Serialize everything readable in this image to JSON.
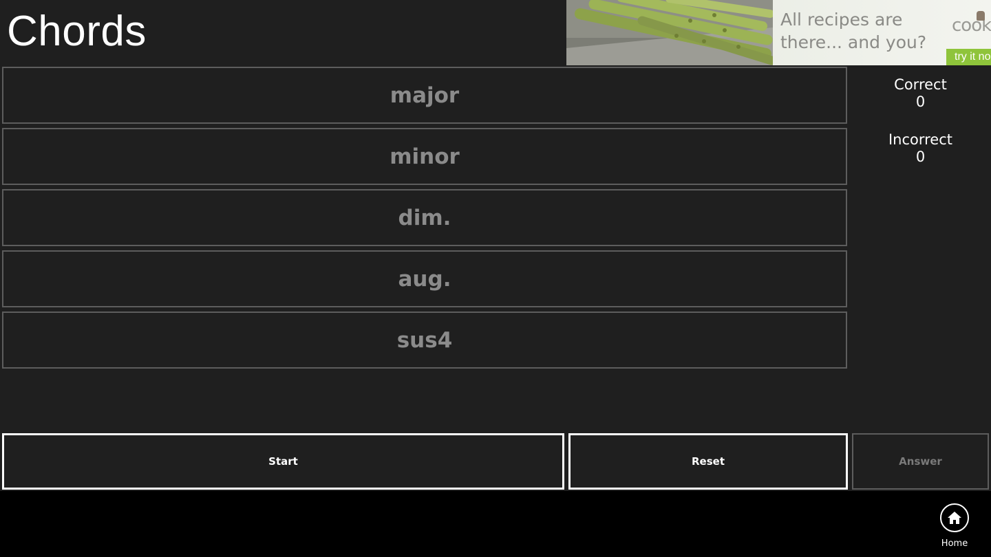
{
  "header": {
    "title": "Chords"
  },
  "ad": {
    "text": "All recipes are there... and you?",
    "brand": "cook",
    "cta": "try it no"
  },
  "options": [
    {
      "label": "major"
    },
    {
      "label": "minor"
    },
    {
      "label": "dim."
    },
    {
      "label": "aug."
    },
    {
      "label": "sus4"
    }
  ],
  "score": {
    "correct_label": "Correct",
    "correct_value": "0",
    "incorrect_label": "Incorrect",
    "incorrect_value": "0"
  },
  "actions": {
    "start_label": "Start",
    "reset_label": "Reset",
    "answer_label": "Answer"
  },
  "app_bar": {
    "home_label": "Home",
    "home_icon": "home-icon"
  },
  "colors": {
    "background": "#1f1f1f",
    "app_bar": "#000000",
    "option_border": "#5d5d5d",
    "option_text": "#8b8b8b",
    "ad_cta": "#8fc43b"
  }
}
